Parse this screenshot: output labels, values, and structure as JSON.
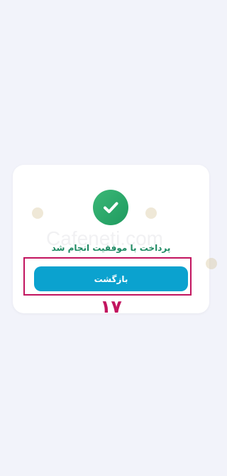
{
  "payment": {
    "message": "پرداخت با موفقیت انجام شد",
    "back_label": "بازگشت",
    "step_number": "۱۷"
  },
  "watermark": {
    "text": "Cafeneti.com"
  },
  "colors": {
    "background": "#f2f3fa",
    "success": "#2aa46a",
    "button": "#0ba2cf",
    "highlight": "#c2145f"
  },
  "icons": {
    "success": "check-circle-icon"
  }
}
